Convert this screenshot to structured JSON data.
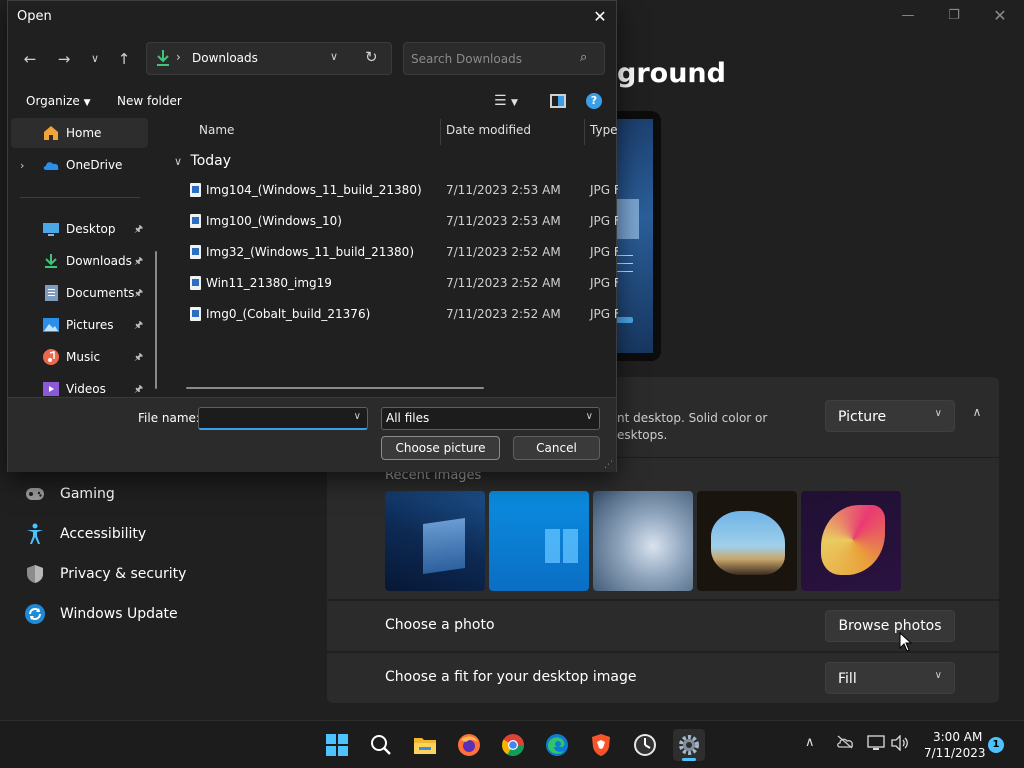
{
  "settings": {
    "heading_visible": "ground",
    "background_desc": "nt desktop. Solid color or\nesktops.",
    "background_type": "Picture",
    "recent_images_label": "Recent images",
    "choose_photo_label": "Choose a photo",
    "browse_photos_label": "Browse photos",
    "choose_fit_label": "Choose a fit for your desktop image",
    "fit_value": "Fill",
    "nav": [
      {
        "label": "Gaming",
        "icon": "gamepad-icon"
      },
      {
        "label": "Accessibility",
        "icon": "accessibility-icon"
      },
      {
        "label": "Privacy & security",
        "icon": "shield-icon"
      },
      {
        "label": "Windows Update",
        "icon": "windows-update-icon"
      }
    ]
  },
  "dialog": {
    "title": "Open",
    "address": {
      "path": "Downloads"
    },
    "search": {
      "placeholder": "Search Downloads"
    },
    "toolbar": {
      "organize": "Organize",
      "new_folder": "New folder",
      "help": "?"
    },
    "nav_pane": [
      {
        "label": "Home",
        "icon": "home-icon",
        "pinned": false
      },
      {
        "label": "OneDrive",
        "icon": "onedrive-icon",
        "pinned": false
      },
      {
        "label": "Desktop",
        "icon": "desktop-icon",
        "pinned": true
      },
      {
        "label": "Downloads",
        "icon": "downloads-icon",
        "pinned": true
      },
      {
        "label": "Documents",
        "icon": "documents-icon",
        "pinned": true
      },
      {
        "label": "Pictures",
        "icon": "pictures-icon",
        "pinned": true
      },
      {
        "label": "Music",
        "icon": "music-icon",
        "pinned": true
      },
      {
        "label": "Videos",
        "icon": "videos-icon",
        "pinned": true
      }
    ],
    "columns": {
      "name": "Name",
      "date": "Date modified",
      "type": "Type"
    },
    "group": "Today",
    "files": [
      {
        "name": "Img104_(Windows_11_build_21380)",
        "date": "7/11/2023 2:53 AM",
        "type": "JPG F"
      },
      {
        "name": "Img100_(Windows_10)",
        "date": "7/11/2023 2:53 AM",
        "type": "JPG F"
      },
      {
        "name": "Img32_(Windows_11_build_21380)",
        "date": "7/11/2023 2:52 AM",
        "type": "JPG F"
      },
      {
        "name": "Win11_21380_img19",
        "date": "7/11/2023 2:52 AM",
        "type": "JPG F"
      },
      {
        "name": "Img0_(Cobalt_build_21376)",
        "date": "7/11/2023 2:52 AM",
        "type": "JPG F"
      }
    ],
    "file_name_label": "File name:",
    "file_name_value": "",
    "file_type": "All files",
    "choose_button": "Choose picture",
    "cancel_button": "Cancel"
  },
  "taskbar": {
    "apps": [
      "start-icon",
      "search-icon",
      "file-explorer-icon",
      "firefox-icon",
      "chrome-icon",
      "edge-icon",
      "brave-icon",
      "clock-app-icon",
      "settings-icon"
    ],
    "time": "3:00 AM",
    "date": "7/11/2023",
    "notifications": "1"
  },
  "colors": {
    "accent": "#4cc2ff",
    "background": "#202020",
    "card": "#2b2b2b"
  }
}
